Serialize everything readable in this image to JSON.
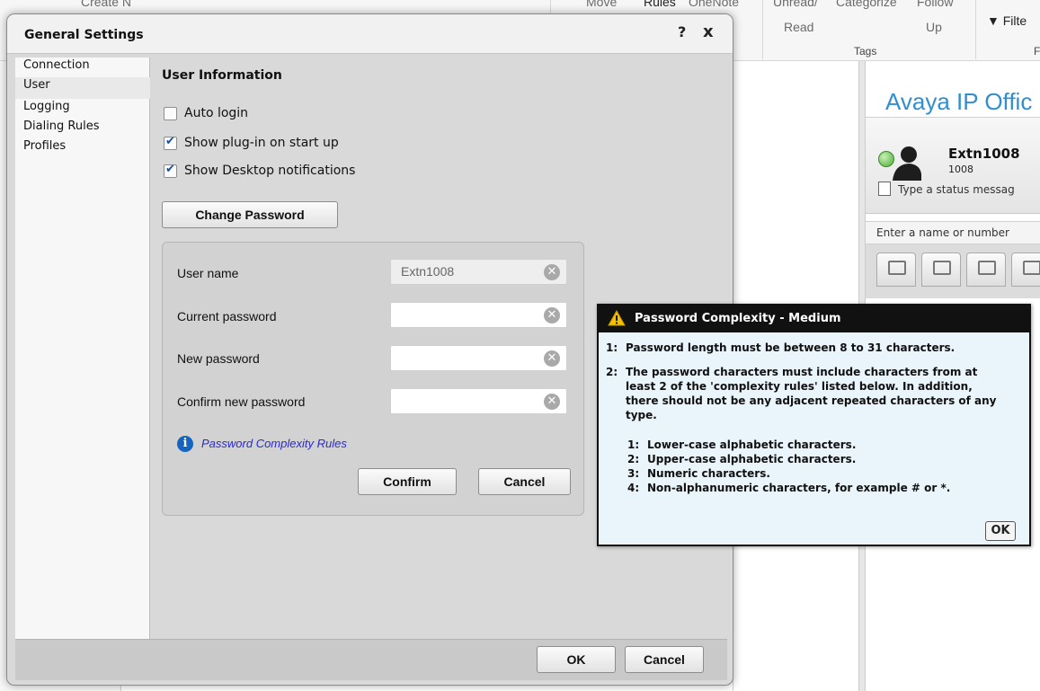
{
  "outlook": {
    "ribbon": {
      "items": [
        "Create N",
        "Move",
        "Rules",
        "OneNote",
        "Unread/",
        "Read",
        "Categorize",
        "Follow",
        "Up",
        "Filte"
      ],
      "group_tags": "Tags",
      "group_f": "F"
    }
  },
  "avaya": {
    "title": "Avaya IP Offic",
    "user_name": "Extn1008",
    "extension": "1008",
    "status_placeholder": "Type a status messag",
    "search_placeholder": "Enter a name or number"
  },
  "dialog": {
    "title": "General Settings",
    "help_label": "?",
    "close_label": "x",
    "nav": {
      "items": [
        {
          "label": "Connection"
        },
        {
          "label": "User"
        },
        {
          "label": "Logging"
        },
        {
          "label": "Dialing Rules"
        },
        {
          "label": "Profiles"
        }
      ],
      "selected": "User"
    },
    "user_info": {
      "heading": "User Information",
      "auto_login": {
        "label": "Auto login",
        "checked": false
      },
      "show_plugin": {
        "label": "Show plug-in on start up",
        "checked": true
      },
      "show_notifications": {
        "label": "Show Desktop notifications",
        "checked": true
      },
      "change_password_label": "Change Password"
    },
    "password": {
      "user_name_label": "User name",
      "user_name_value": "Extn1008",
      "current_label": "Current password",
      "current_value": "",
      "new_label": "New password",
      "new_value": "",
      "confirm_label": "Confirm new password",
      "confirm_value": "",
      "complexity_link": "Password Complexity Rules",
      "confirm_button": "Confirm",
      "cancel_button": "Cancel"
    },
    "footer": {
      "ok_label": "OK",
      "cancel_label": "Cancel"
    }
  },
  "popup": {
    "title": "Password Complexity - Medium",
    "rules": [
      {
        "num": "1:",
        "text": "Password length must be between 8 to 31 characters."
      },
      {
        "num": "2:",
        "text": "The password characters must include characters from at least 2 of the 'complexity rules' listed below. In addition, there should not be any adjacent repeated characters of any type."
      }
    ],
    "sub_rules": [
      {
        "num": "1:",
        "text": "Lower-case alphabetic characters."
      },
      {
        "num": "2:",
        "text": "Upper-case alphabetic characters."
      },
      {
        "num": "3:",
        "text": "Numeric characters."
      },
      {
        "num": "4:",
        "text": "Non-alphanumeric characters, for example # or *."
      }
    ],
    "ok_label": "OK"
  },
  "colors": {
    "accent_blue": "#2f8fd0",
    "link_blue": "#2a2ad0",
    "popup_bg": "#e9f4fb",
    "popup_header": "#111111",
    "warning_yellow": "#f5c000"
  }
}
